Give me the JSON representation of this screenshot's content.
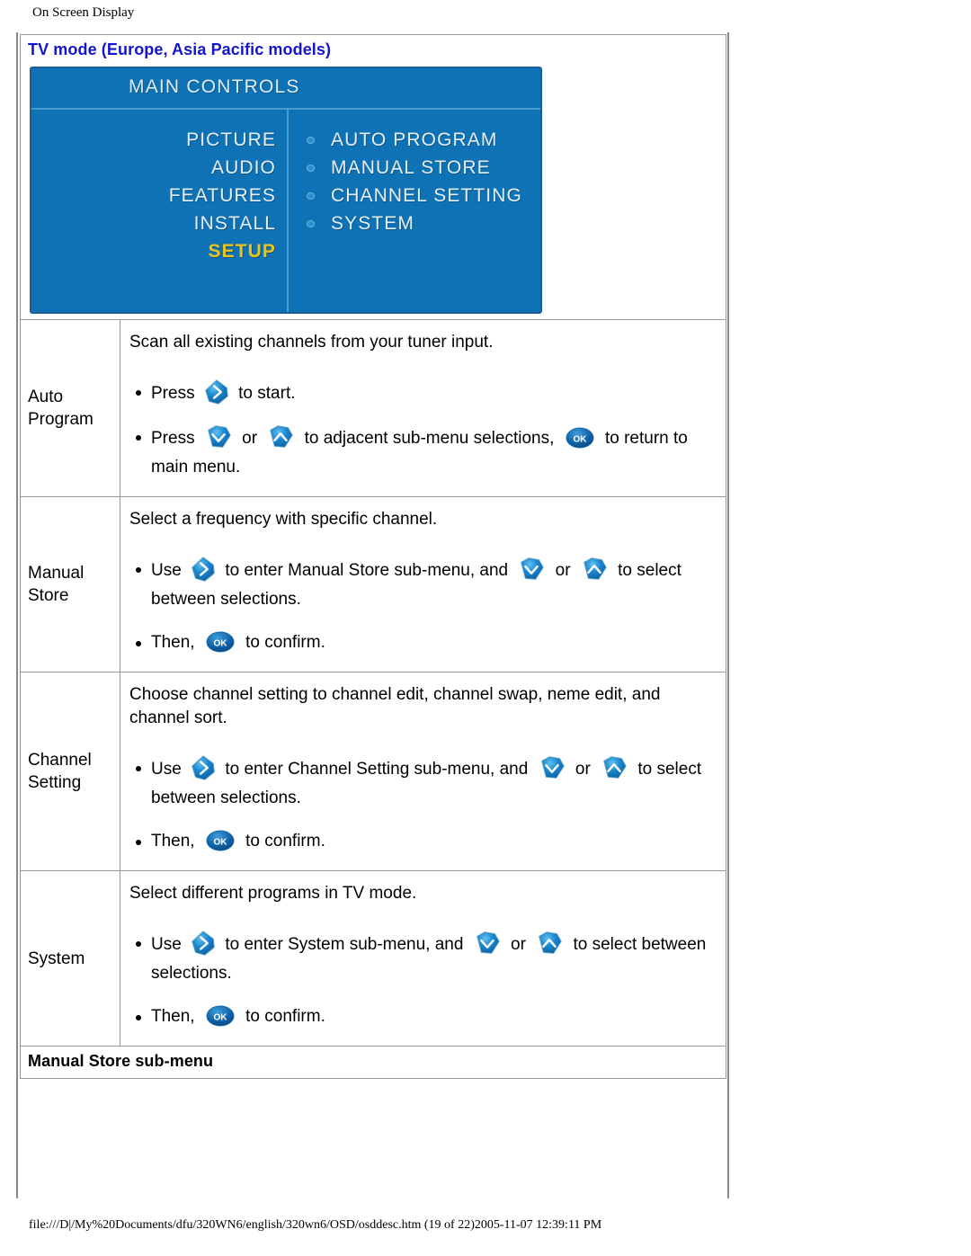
{
  "header": {
    "title": "On Screen Display"
  },
  "footer": {
    "path": "file:///D|/My%20Documents/dfu/320WN6/english/320wn6/OSD/osddesc.htm (19 of 22)2005-11-07 12:39:11 PM"
  },
  "sections": {
    "tv_mode_title": "TV mode (Europe, Asia Pacific models)",
    "manual_store_title": "Manual Store sub-menu"
  },
  "osd": {
    "title": "MAIN  CONTROLS",
    "left_items": [
      {
        "label": "PICTURE",
        "selected": false
      },
      {
        "label": "AUDIO",
        "selected": false
      },
      {
        "label": "FEATURES",
        "selected": false
      },
      {
        "label": "INSTALL",
        "selected": false
      },
      {
        "label": "SETUP",
        "selected": true
      }
    ],
    "right_items": [
      {
        "label": "AUTO PROGRAM"
      },
      {
        "label": "MANUAL STORE"
      },
      {
        "label": "CHANNEL SETTING"
      },
      {
        "label": "SYSTEM"
      }
    ],
    "colors": {
      "background": "#0f72b4",
      "border": "#1b5e99",
      "divider": "#4a9bd0",
      "text": "#e6eef6",
      "selected_text": "#e9c41d"
    }
  },
  "rows": {
    "auto_program": {
      "label": "Auto\nProgram",
      "label_line1": "Auto",
      "label_line2": "Program",
      "intro": "Scan all existing channels from your tuner input.",
      "b1_a": "Press",
      "b1_b": "to start.",
      "b2_a": "Press",
      "b2_or": "or",
      "b2_b": "to adjacent sub-menu selections,",
      "b2_c": "to return to main menu."
    },
    "manual_store": {
      "label_line1": "Manual",
      "label_line2": "Store",
      "intro": "Select a frequency with specific channel.",
      "b1_a": "Use",
      "b1_b": "to enter Manual Store sub-menu, and",
      "b1_or": "or",
      "b1_c": "to select between selections.",
      "b2_a": "Then,",
      "b2_b": "to confirm."
    },
    "channel_setting": {
      "label_line1": "Channel",
      "label_line2": "Setting",
      "intro": "Choose channel setting to channel edit, channel swap, neme edit, and channel sort.",
      "b1_a": "Use",
      "b1_b": "to enter Channel Setting sub-menu, and",
      "b1_or": "or",
      "b1_c": "to select between selections.",
      "b2_a": "Then,",
      "b2_b": "to confirm."
    },
    "system": {
      "label_line1": "System",
      "label_line2": "",
      "intro": "Select different programs in TV mode.",
      "b1_a": "Use",
      "b1_b": "to enter System sub-menu, and",
      "b1_or": "or",
      "b1_c": "to select between selections.",
      "b2_a": "Then,",
      "b2_b": "to confirm."
    }
  },
  "keys": {
    "right": "right-arrow-key",
    "down": "down-arrow-key",
    "up": "up-arrow-key",
    "ok": "ok-key",
    "ok_label": "OK"
  },
  "colors": {
    "heading_blue": "#1415cd",
    "table_border": "#9a9a94",
    "frame_border": "#888a85"
  }
}
